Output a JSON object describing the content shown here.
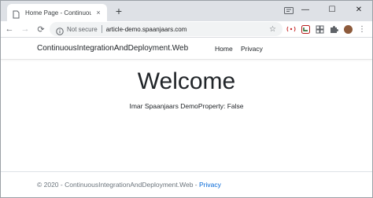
{
  "browser": {
    "tab_title": "Home Page - ContinuousIntegrat",
    "tab_close": "×",
    "new_tab": "+",
    "window_controls": {
      "minimize": "—",
      "maximize": "☐",
      "close": "✕"
    },
    "nav": {
      "back": "←",
      "forward": "→",
      "reload": "⟳"
    },
    "security_label": "Not secure",
    "url": "article-demo.spaanjaars.com",
    "star": "☆",
    "menu": "⋮"
  },
  "site": {
    "brand": "ContinuousIntegrationAndDeployment.Web",
    "nav": [
      {
        "label": "Home"
      },
      {
        "label": "Privacy"
      }
    ],
    "heading": "Welcome",
    "demo_line": "Imar Spaanjaars DemoProperty: False",
    "footer": {
      "prefix": "© 2020 - ContinuousIntegrationAndDeployment.Web - ",
      "link": "Privacy"
    }
  },
  "colors": {
    "tabstrip_bg": "#dee1e6",
    "link": "#0366d6",
    "footer_text": "#6c757d"
  }
}
